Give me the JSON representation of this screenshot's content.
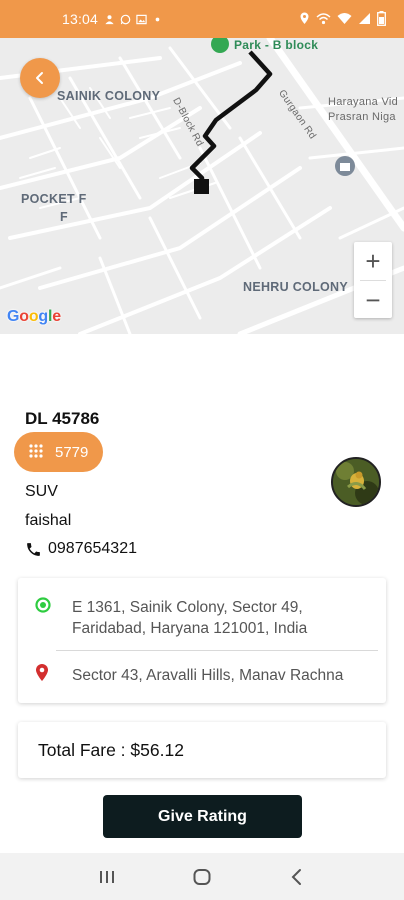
{
  "status_bar": {
    "time": "13:04"
  },
  "map": {
    "labels": {
      "sainik_colony": "SAINIK COLONY",
      "pocket_f": "POCKET F",
      "pocket_f_2": "F",
      "nehru_colony": "NEHRU COLONY",
      "park": "Park - B block",
      "haryana_1": "Harayana Vid",
      "haryana_2": "Prasran Niga",
      "d_block_rd": "D-Block Rd",
      "gurgaon_rd": "Gurgaon Rd"
    },
    "google": [
      "G",
      "o",
      "o",
      "g",
      "l",
      "e"
    ],
    "google_colors": [
      "#4285F4",
      "#EA4335",
      "#FBBC05",
      "#4285F4",
      "#34A853",
      "#EA4335"
    ],
    "zoom_in": "+",
    "zoom_out": "−"
  },
  "ride": {
    "vehicle_number": "DL 45786",
    "otp": "5779",
    "vehicle_type": "SUV",
    "driver_name": "faishal",
    "phone": "0987654321"
  },
  "route": {
    "pickup": "E 1361, Sainik Colony, Sector 49, Faridabad, Haryana 121001, India",
    "drop": "Sector 43, Aravalli Hills, Manav Rachna",
    "pickup_color": "#2ecc40",
    "drop_color": "#d32f2f"
  },
  "fare": {
    "label": "Total Fare : $56.12"
  },
  "actions": {
    "give_rating": "Give Rating"
  },
  "colors": {
    "accent": "#f0984a",
    "button_dark": "#0d1c1f"
  }
}
